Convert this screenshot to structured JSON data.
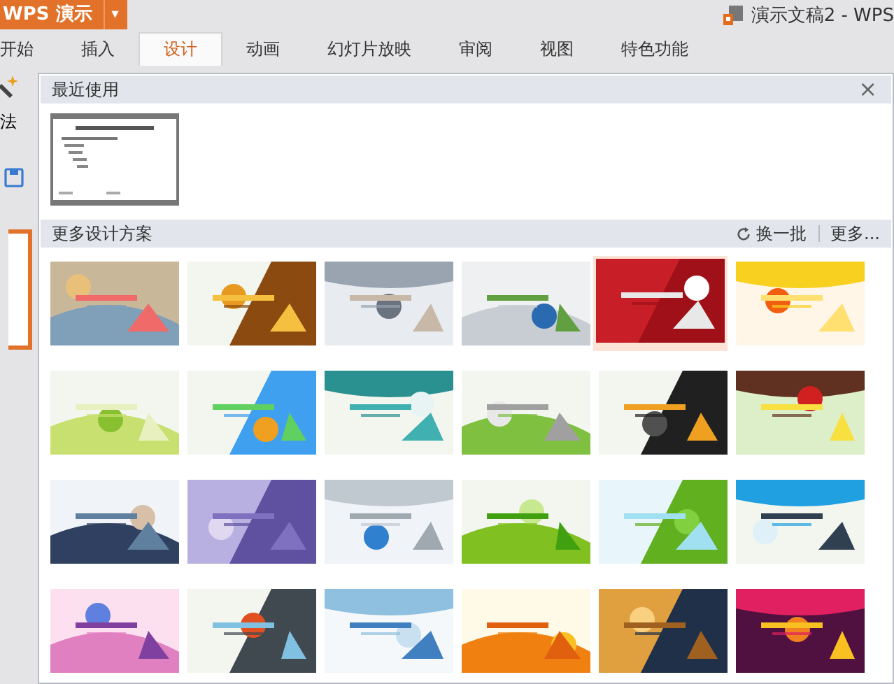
{
  "app_menu": {
    "label": "WPS 演示",
    "arrow": "▾"
  },
  "window": {
    "title": "演示文稿2 - WPS"
  },
  "tabs": [
    {
      "label": "开始",
      "selected": false
    },
    {
      "label": "插入",
      "selected": false
    },
    {
      "label": "设计",
      "selected": true
    },
    {
      "label": "动画",
      "selected": false
    },
    {
      "label": "幻灯片放映",
      "selected": false
    },
    {
      "label": "审阅",
      "selected": false
    },
    {
      "label": "视图",
      "selected": false
    },
    {
      "label": "特色功能",
      "selected": false
    }
  ],
  "ribbon_left": {
    "label": "法"
  },
  "gallery": {
    "recent_title": "最近使用",
    "close": "×",
    "more_title": "更多设计方案",
    "refresh": "换一批",
    "more": "更多...",
    "templates": [
      {
        "selected": false
      },
      {
        "selected": false
      },
      {
        "selected": false
      },
      {
        "selected": false
      },
      {
        "selected": true
      },
      {
        "selected": false
      },
      {
        "selected": false
      },
      {
        "selected": false
      },
      {
        "selected": false
      },
      {
        "selected": false
      },
      {
        "selected": false
      },
      {
        "selected": false
      },
      {
        "selected": false
      },
      {
        "selected": false
      },
      {
        "selected": false
      },
      {
        "selected": false
      },
      {
        "selected": false
      },
      {
        "selected": false
      },
      {
        "selected": false
      },
      {
        "selected": false
      },
      {
        "selected": false
      },
      {
        "selected": false
      },
      {
        "selected": false
      },
      {
        "selected": false
      }
    ]
  }
}
